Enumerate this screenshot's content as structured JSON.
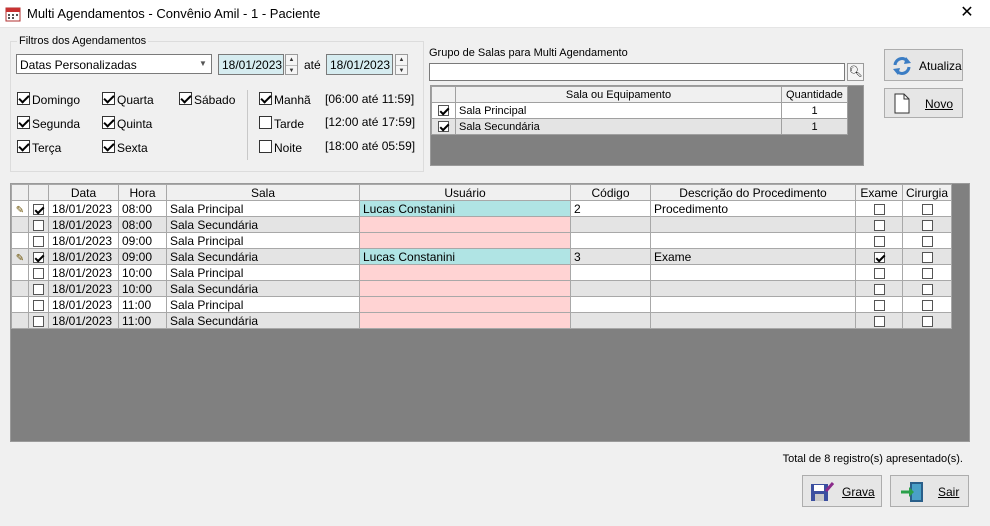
{
  "window": {
    "title": "Multi Agendamentos - Convênio Amil - 1 - Paciente",
    "close_glyph": "✕"
  },
  "filters": {
    "group_title": "Filtros dos Agendamentos",
    "period_select": "Datas Personalizadas",
    "date_from": "18/01/2023",
    "until_label": "até",
    "date_to": "18/01/2023",
    "days": [
      {
        "label": "Domingo",
        "checked": true
      },
      {
        "label": "Segunda",
        "checked": true
      },
      {
        "label": "Terça",
        "checked": true
      },
      {
        "label": "Quarta",
        "checked": true
      },
      {
        "label": "Quinta",
        "checked": true
      },
      {
        "label": "Sexta",
        "checked": true
      },
      {
        "label": "Sábado",
        "checked": true
      }
    ],
    "shifts": [
      {
        "label": "Manhã",
        "checked": true,
        "range": "[06:00 até 11:59]"
      },
      {
        "label": "Tarde",
        "checked": false,
        "range": "[12:00 até 17:59]"
      },
      {
        "label": "Noite",
        "checked": false,
        "range": "[18:00 até 05:59]"
      }
    ]
  },
  "room_group": {
    "title": "Grupo de Salas para Multi Agendamento",
    "search_value": "",
    "headers": {
      "room": "Sala ou Equipamento",
      "qty": "Quantidade"
    },
    "rows": [
      {
        "checked": true,
        "room": "Sala Principal",
        "qty": "1"
      },
      {
        "checked": true,
        "room": "Sala Secundária",
        "qty": "1"
      }
    ]
  },
  "buttons": {
    "refresh": "Atualiza",
    "new": "Novo",
    "save": "Grava",
    "exit": "Sair"
  },
  "grid": {
    "headers": {
      "date": "Data",
      "time": "Hora",
      "room": "Sala",
      "user": "Usuário",
      "code": "Código",
      "desc": "Descrição do Procedimento",
      "exam": "Exame",
      "surgery": "Cirurgia"
    },
    "rows": [
      {
        "edit": true,
        "checked": true,
        "date": "18/01/2023",
        "time": "08:00",
        "room": "Sala Principal",
        "user": "Lucas Constanini",
        "code": "2",
        "desc": "Procedimento",
        "exam": false,
        "surgery": false
      },
      {
        "edit": false,
        "checked": false,
        "date": "18/01/2023",
        "time": "08:00",
        "room": "Sala Secundária",
        "user": "",
        "code": "",
        "desc": "",
        "exam": false,
        "surgery": false
      },
      {
        "edit": false,
        "checked": false,
        "date": "18/01/2023",
        "time": "09:00",
        "room": "Sala Principal",
        "user": "",
        "code": "",
        "desc": "",
        "exam": false,
        "surgery": false
      },
      {
        "edit": true,
        "checked": true,
        "date": "18/01/2023",
        "time": "09:00",
        "room": "Sala Secundária",
        "user": "Lucas Constanini",
        "code": "3",
        "desc": "Exame",
        "exam": true,
        "surgery": false
      },
      {
        "edit": false,
        "checked": false,
        "date": "18/01/2023",
        "time": "10:00",
        "room": "Sala Principal",
        "user": "",
        "code": "",
        "desc": "",
        "exam": false,
        "surgery": false
      },
      {
        "edit": false,
        "checked": false,
        "date": "18/01/2023",
        "time": "10:00",
        "room": "Sala Secundária",
        "user": "",
        "code": "",
        "desc": "",
        "exam": false,
        "surgery": false
      },
      {
        "edit": false,
        "checked": false,
        "date": "18/01/2023",
        "time": "11:00",
        "room": "Sala Principal",
        "user": "",
        "code": "",
        "desc": "",
        "exam": false,
        "surgery": false
      },
      {
        "edit": false,
        "checked": false,
        "date": "18/01/2023",
        "time": "11:00",
        "room": "Sala Secundária",
        "user": "",
        "code": "",
        "desc": "",
        "exam": false,
        "surgery": false
      }
    ]
  },
  "footer": {
    "total_text": "Total de 8 registro(s) apresentado(s)."
  }
}
